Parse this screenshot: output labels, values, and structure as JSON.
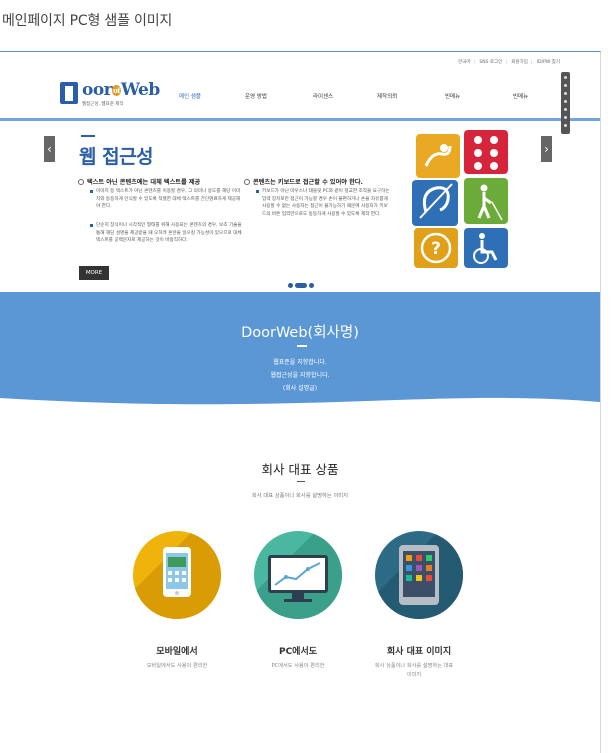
{
  "caption": "메인페이지 PC형 샘플 이미지",
  "util_links": [
    "한국어",
    "SNS 로그인",
    "회원가입",
    "ID/PW 찾기"
  ],
  "logo": {
    "name_a": "oor",
    "name_of": "of",
    "name_b": "Web",
    "tagline": "웹접근성, 웹표준 제작"
  },
  "nav": [
    "메인 샘플",
    "운영 방법",
    "라이센스",
    "제작의뢰",
    "빈메뉴",
    "빈메뉴"
  ],
  "slider": {
    "title": "웹 접근성",
    "left_heading": "텍스트 아닌 콘텐츠에는 대체 텍스트를 제공",
    "left_items": [
      "이미지 등 텍스트가 아닌 콘텐츠를 이용할 경우, 그 의미나 용도를 해당 이미지와 동등하게 인식할 수 있도록 적절한 대체 텍스트를 간단명료하게 제공해야 한다.",
      "단순히 장식이나 시각적인 형태를 위해 사용되는 콘텐츠의 경우, 보조 기술을 통해 해당 설명을 제공받을 때 오히려 혼란을 일으킬 가능성이 있으므로 대체 텍스트를 공백문자로 제공하는 것이 바람직하다."
    ],
    "right_heading": "콘텐츠는 키보드로 접근할 수 있어야 한다.",
    "right_items": [
      "키보드가 아닌 마우스나 태블릿 PC와 같이 정교한 조작을 요구하는 입력 장치로만 접근이 가능할 경우 손이 불편하거나 손을 자유롭게 사용할 수 없는 사용자는 접근이 불가능하기 때문에 사용자가 키보드의 버튼 입력만으로도 동등하게 사용할 수 있도록 제작 한다."
    ],
    "more": "MORE",
    "prev": "‹",
    "next": "›"
  },
  "banner": {
    "title": "DoorWeb(회사명)",
    "lines": [
      "웹표준을 지향합니다.",
      "웹접근성을 지향합니다.",
      "(회사 설명글)"
    ],
    "color": "#5b97d5"
  },
  "products": {
    "title": "회사 대표 상품",
    "subtitle": "회사 대표 상품이나 회사를 설명하는 이미지",
    "items": [
      {
        "name": "모바일에서",
        "desc": "모바일에서도 사용이 편리한",
        "color": "#efb30b"
      },
      {
        "name": "PC에서도",
        "desc": "PC에서도 사용이 편리한",
        "color": "#4ab8a0"
      },
      {
        "name": "회사 대표 이미지",
        "desc": "회사 상품이나 회사를 설명하는 대표 이미지",
        "color": "#2d6a85"
      }
    ]
  }
}
